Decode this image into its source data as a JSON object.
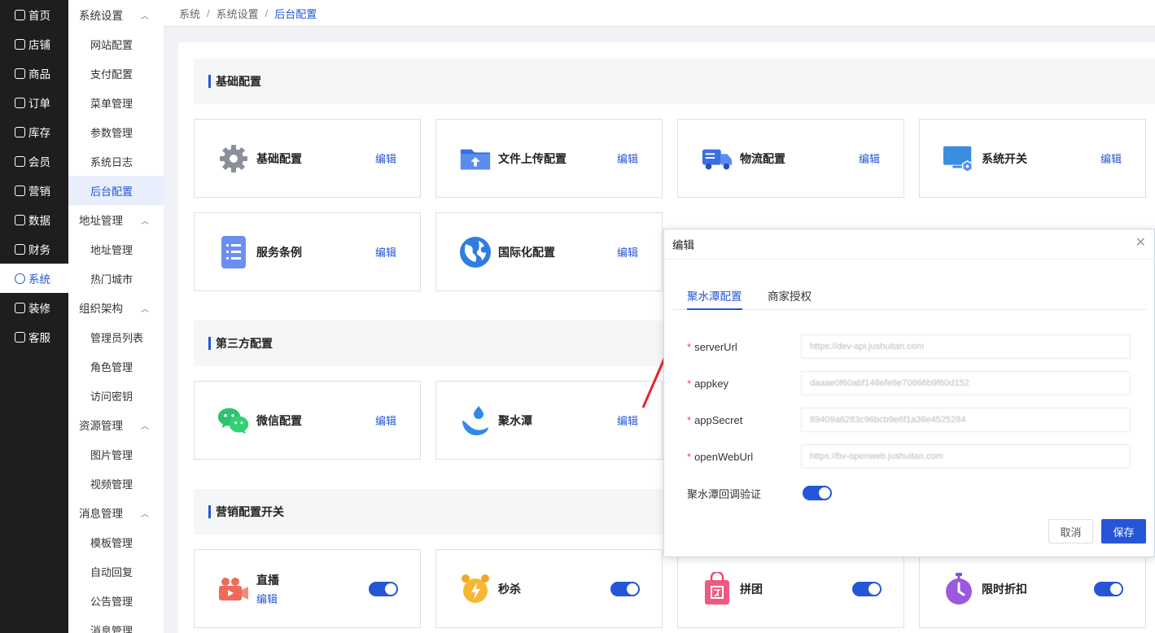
{
  "nav1": [
    {
      "label": "首页",
      "icon": "home-icon"
    },
    {
      "label": "店铺",
      "icon": "store-icon"
    },
    {
      "label": "商品",
      "icon": "goods-icon"
    },
    {
      "label": "订单",
      "icon": "order-icon"
    },
    {
      "label": "库存",
      "icon": "inventory-icon"
    },
    {
      "label": "会员",
      "icon": "member-icon"
    },
    {
      "label": "营销",
      "icon": "gift-icon"
    },
    {
      "label": "数据",
      "icon": "data-icon"
    },
    {
      "label": "财务",
      "icon": "finance-icon"
    },
    {
      "label": "系统",
      "icon": "gear-icon"
    },
    {
      "label": "装修",
      "icon": "decorate-icon"
    },
    {
      "label": "客服",
      "icon": "chat-icon"
    }
  ],
  "nav2": {
    "groups": [
      {
        "title": "系统设置",
        "items": [
          "网站配置",
          "支付配置",
          "菜单管理",
          "参数管理",
          "系统日志",
          "后台配置"
        ]
      },
      {
        "title": "地址管理",
        "items": [
          "地址管理",
          "热门城市"
        ]
      },
      {
        "title": "组织架构",
        "items": [
          "管理员列表",
          "角色管理",
          "访问密钥"
        ]
      },
      {
        "title": "资源管理",
        "items": [
          "图片管理",
          "视频管理"
        ]
      },
      {
        "title": "消息管理",
        "items": [
          "模板管理",
          "自动回复",
          "公告管理",
          "消息管理"
        ]
      }
    ]
  },
  "breadcrumb": [
    "系统",
    "系统设置",
    "后台配置"
  ],
  "sections": {
    "basic": "基础配置",
    "third": "第三方配置",
    "marketing": "营销配置开关"
  },
  "edit_label": "编辑",
  "cards": {
    "basic": "基础配置",
    "upload": "文件上传配置",
    "logistics": "物流配置",
    "switch": "系统开关",
    "terms": "服务条例",
    "i18n": "国际化配置",
    "wechat": "微信配置",
    "jst": "聚水潭",
    "live": "直播",
    "seckill": "秒杀",
    "group": "拼团",
    "discount": "限时折扣"
  },
  "dialog": {
    "title": "编辑",
    "tabs": [
      "聚水潭配置",
      "商家授权"
    ],
    "fields": [
      {
        "label": "serverUrl",
        "value": "https://dev-api.jushuitan.com"
      },
      {
        "label": "appkey",
        "value": "daaae0f60abf148efe8e70666b9f60d152"
      },
      {
        "label": "appSecret",
        "value": "89409a6283c96bcb9e6f1a36e4525284"
      },
      {
        "label": "openWebUrl",
        "value": "https://bv-openweb.jushuitan.com"
      }
    ],
    "toggle_label": "聚水潭回调验证",
    "cancel": "取消",
    "save": "保存"
  },
  "colors": {
    "accent": "#2456d6",
    "sidebar": "#1e1e1e"
  }
}
